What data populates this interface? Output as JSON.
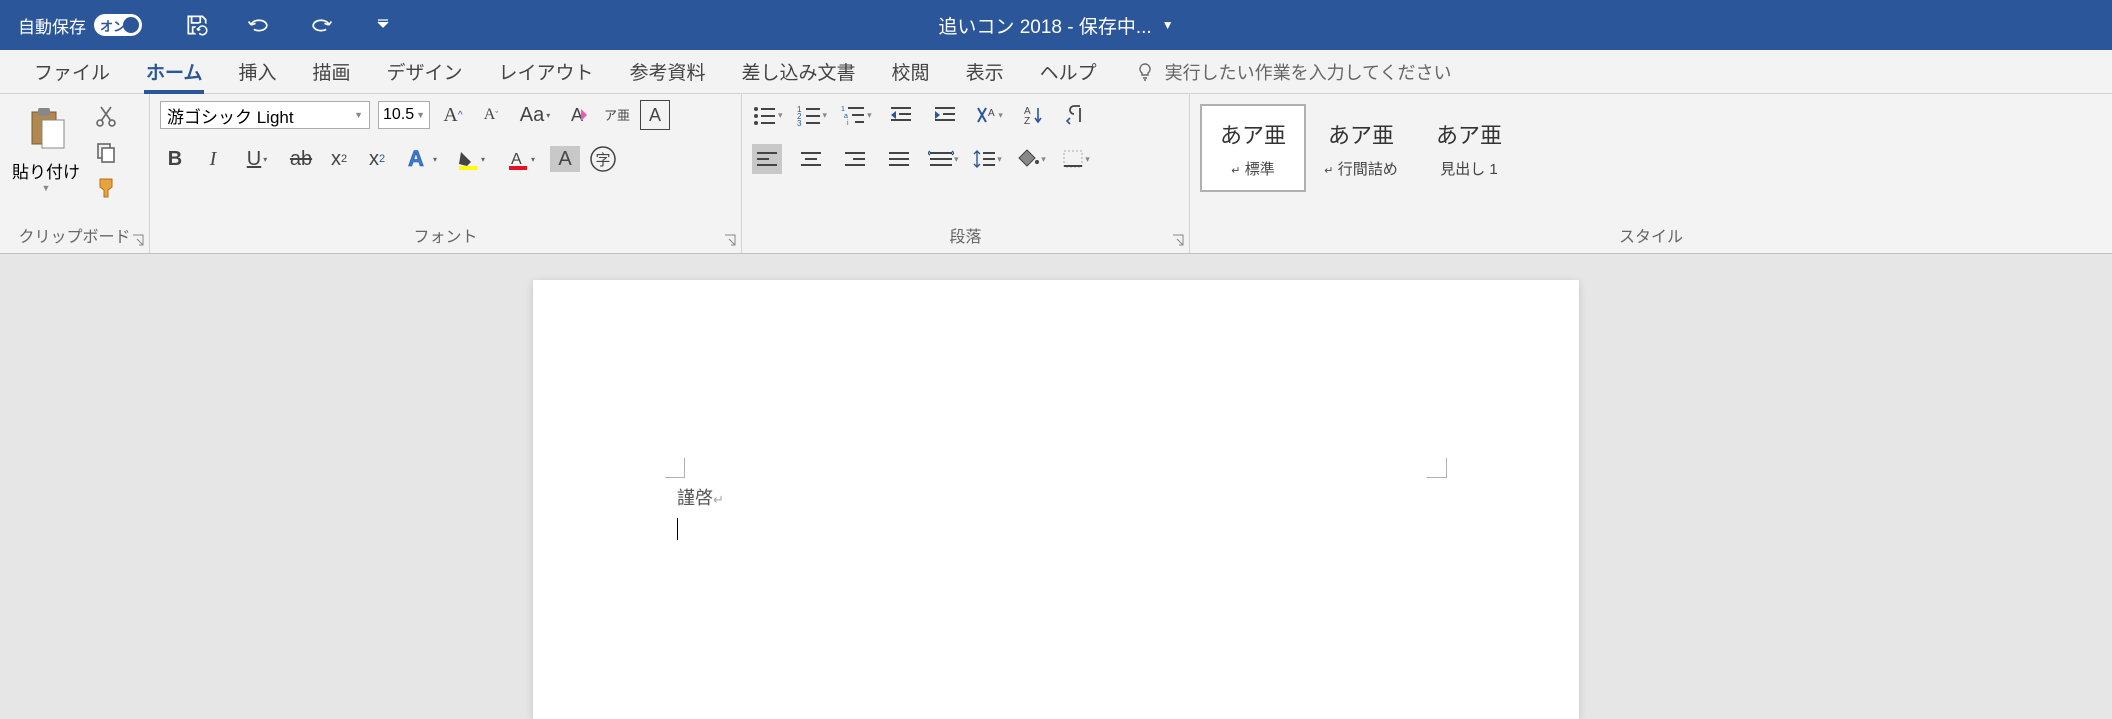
{
  "titlebar": {
    "autosave_label": "自動保存",
    "autosave_state": "オン",
    "document_title": "追いコン 2018 - 保存中..."
  },
  "tabs": {
    "file": "ファイル",
    "home": "ホーム",
    "insert": "挿入",
    "draw": "描画",
    "design": "デザイン",
    "layout": "レイアウト",
    "references": "参考資料",
    "mailings": "差し込み文書",
    "review": "校閲",
    "view": "表示",
    "help": "ヘルプ",
    "tellme_placeholder": "実行したい作業を入力してください"
  },
  "ribbon": {
    "clipboard": {
      "label": "クリップボード",
      "paste": "貼り付け"
    },
    "font": {
      "label": "フォント",
      "name": "游ゴシック Light",
      "size": "10.5",
      "ruby": "ア亜",
      "char_border_glyph": "A",
      "enclosed_glyph": "字"
    },
    "paragraph": {
      "label": "段落"
    },
    "styles": {
      "label": "スタイル",
      "preview": "あア亜",
      "items": [
        {
          "name": "標準",
          "active": true
        },
        {
          "name": "行間詰め",
          "active": false
        },
        {
          "name": "見出し 1",
          "active": false
        }
      ]
    }
  },
  "document": {
    "body_text": "謹啓"
  }
}
